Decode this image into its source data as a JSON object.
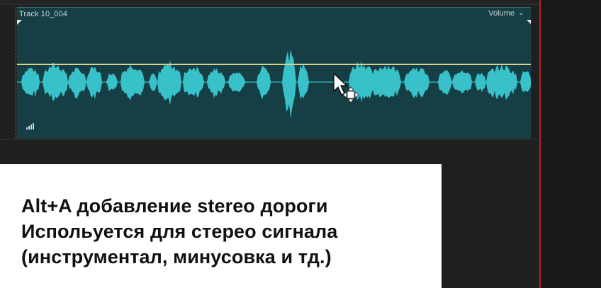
{
  "clip": {
    "name": "Track 10_004",
    "effect_label": "Volume",
    "effect_chevron": "⌄",
    "waveform_color": "#38c1c8",
    "volume_line_color": "#d8d38c",
    "background_color": "#153e45"
  },
  "caption": {
    "lines": [
      "Alt+A добавление stereo дороги",
      "Испольуется для стерео сигнала",
      "(инструментал, минусовка и тд.)"
    ]
  },
  "icons": {
    "meter": "level-meter-icon",
    "cursor": "move-cursor-icon"
  }
}
